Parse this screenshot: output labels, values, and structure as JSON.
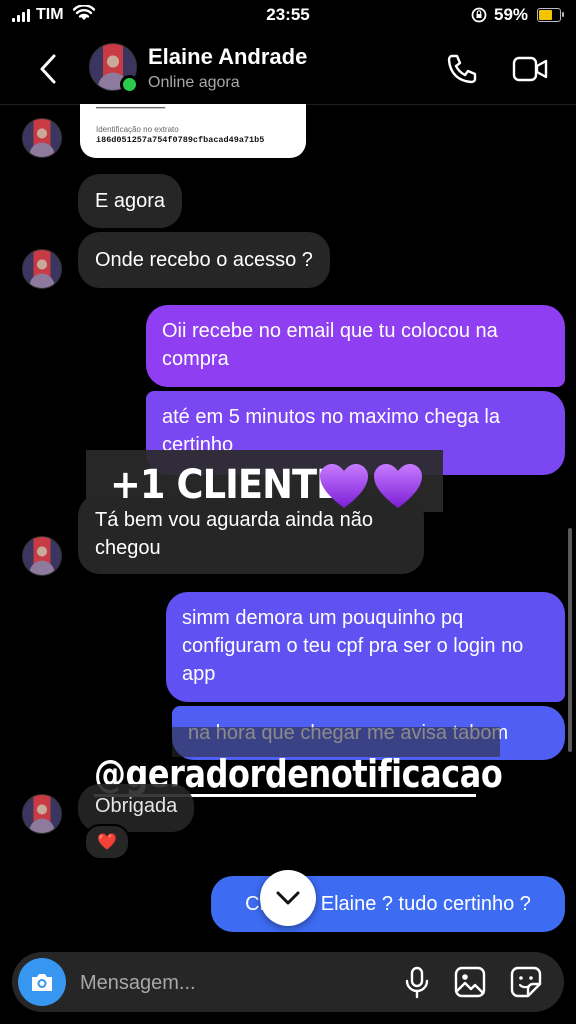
{
  "status_bar": {
    "carrier": "TIM",
    "time": "23:55",
    "battery_percent": "59%"
  },
  "header": {
    "contact_name": "Elaine Andrade",
    "contact_status": "Online agora"
  },
  "receipt": {
    "label": "Identificação no extrato",
    "value": "i86d051257a754f0789cfbacad49a71b5"
  },
  "messages": [
    {
      "dir": "in",
      "text": "E agora"
    },
    {
      "dir": "in",
      "text": "Onde recebo o acesso ?"
    },
    {
      "dir": "out",
      "text": "Oii recebe no email que tu colocou na compra"
    },
    {
      "dir": "out",
      "text": "até em 5 minutos no maximo chega la certinho"
    },
    {
      "dir": "in",
      "text": "Tá bem vou aguarda ainda não chegou"
    },
    {
      "dir": "out",
      "text": "simm demora um pouquinho pq configuram o teu cpf pra ser o login no app"
    },
    {
      "dir": "out",
      "text": "na hora que chegar me avisa tabom"
    },
    {
      "dir": "in",
      "text": "Obrigada"
    },
    {
      "dir": "out",
      "text": "Chegou Elaine ? tudo certinho ?"
    }
  ],
  "reaction": "❤️",
  "stickers": {
    "clients": "+1 CLIENTE",
    "handle": "@geradordenotificacao"
  },
  "composer": {
    "placeholder": "Mensagem..."
  },
  "colors": {
    "incoming": "#262626",
    "accent_blue": "#3797f0",
    "gradient_top": "#8e3ff2",
    "gradient_bottom": "#3d6bf3"
  }
}
